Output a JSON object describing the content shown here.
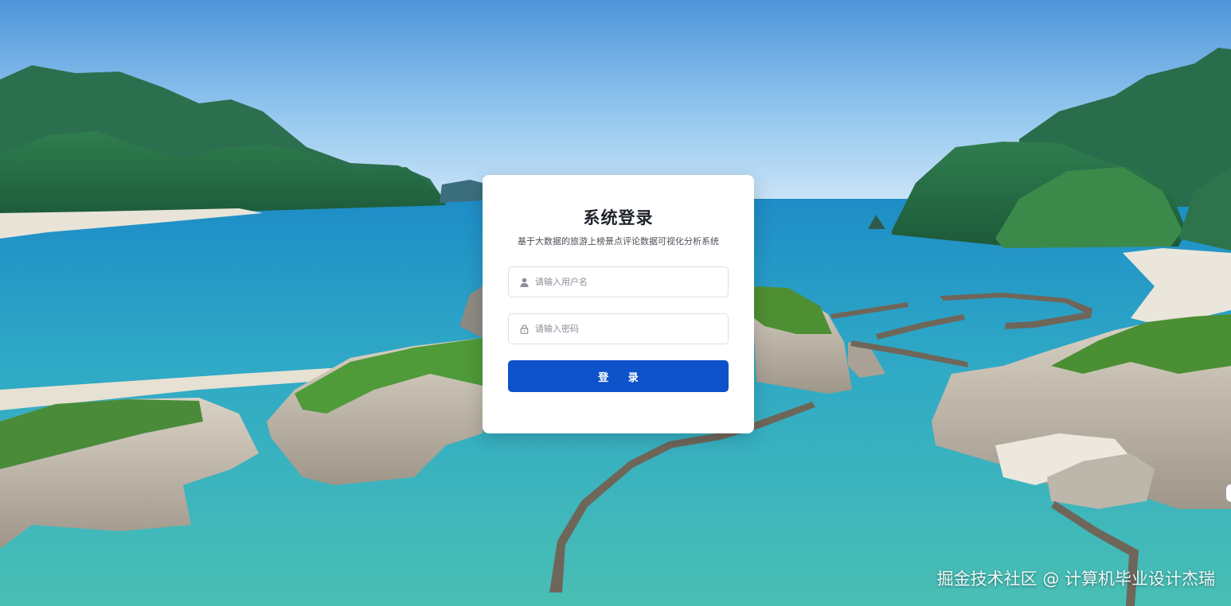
{
  "login": {
    "title": "系统登录",
    "subtitle": "基于大数据的旅游上榜景点评论数据可视化分析系统",
    "username_placeholder": "请输入用户名",
    "password_placeholder": "请输入密码",
    "submit_label": "登 录"
  },
  "watermark": "掘金技术社区 @ 计算机毕业设计杰瑞",
  "colors": {
    "accent": "#0e52c9",
    "sky": "#8fc4ef",
    "sea": "#2a9cc6",
    "lagoon": "#4fbfb3"
  },
  "icons": {
    "username": "user-icon",
    "password": "lock-icon"
  }
}
